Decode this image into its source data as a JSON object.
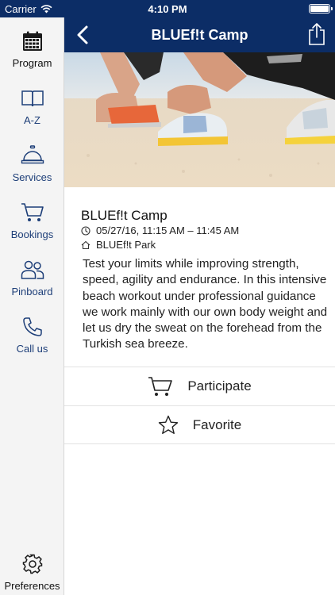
{
  "status_bar": {
    "carrier": "Carrier",
    "time": "4:10 PM"
  },
  "nav": {
    "title": "BLUEf!t Camp"
  },
  "sidebar": {
    "items": [
      {
        "label": "Program",
        "icon": "calendar-icon"
      },
      {
        "label": "A-Z",
        "icon": "book-icon"
      },
      {
        "label": "Services",
        "icon": "service-bell-icon"
      },
      {
        "label": "Bookings",
        "icon": "cart-icon"
      },
      {
        "label": "Pinboard",
        "icon": "people-icon"
      },
      {
        "label": "Call us",
        "icon": "phone-icon"
      }
    ],
    "preferences": {
      "label": "Preferences",
      "icon": "gear-icon"
    }
  },
  "event": {
    "title": "BLUEf!t Camp",
    "datetime": "05/27/16, 11:15 AM – 11:45 AM",
    "location": "BLUEf!t Park",
    "description": "Test your limits while improving strength, speed, agility and endurance. In this intensive beach workout under professional guidance we work mainly with our own body weight and let us dry the sweat on the forehead from the Turkish sea breeze."
  },
  "actions": {
    "participate": "Participate",
    "favorite": "Favorite"
  },
  "colors": {
    "nav_bar": "#0c2d66",
    "sidebar_label": "#1d3e78",
    "sidebar_bg": "#f4f4f4"
  }
}
